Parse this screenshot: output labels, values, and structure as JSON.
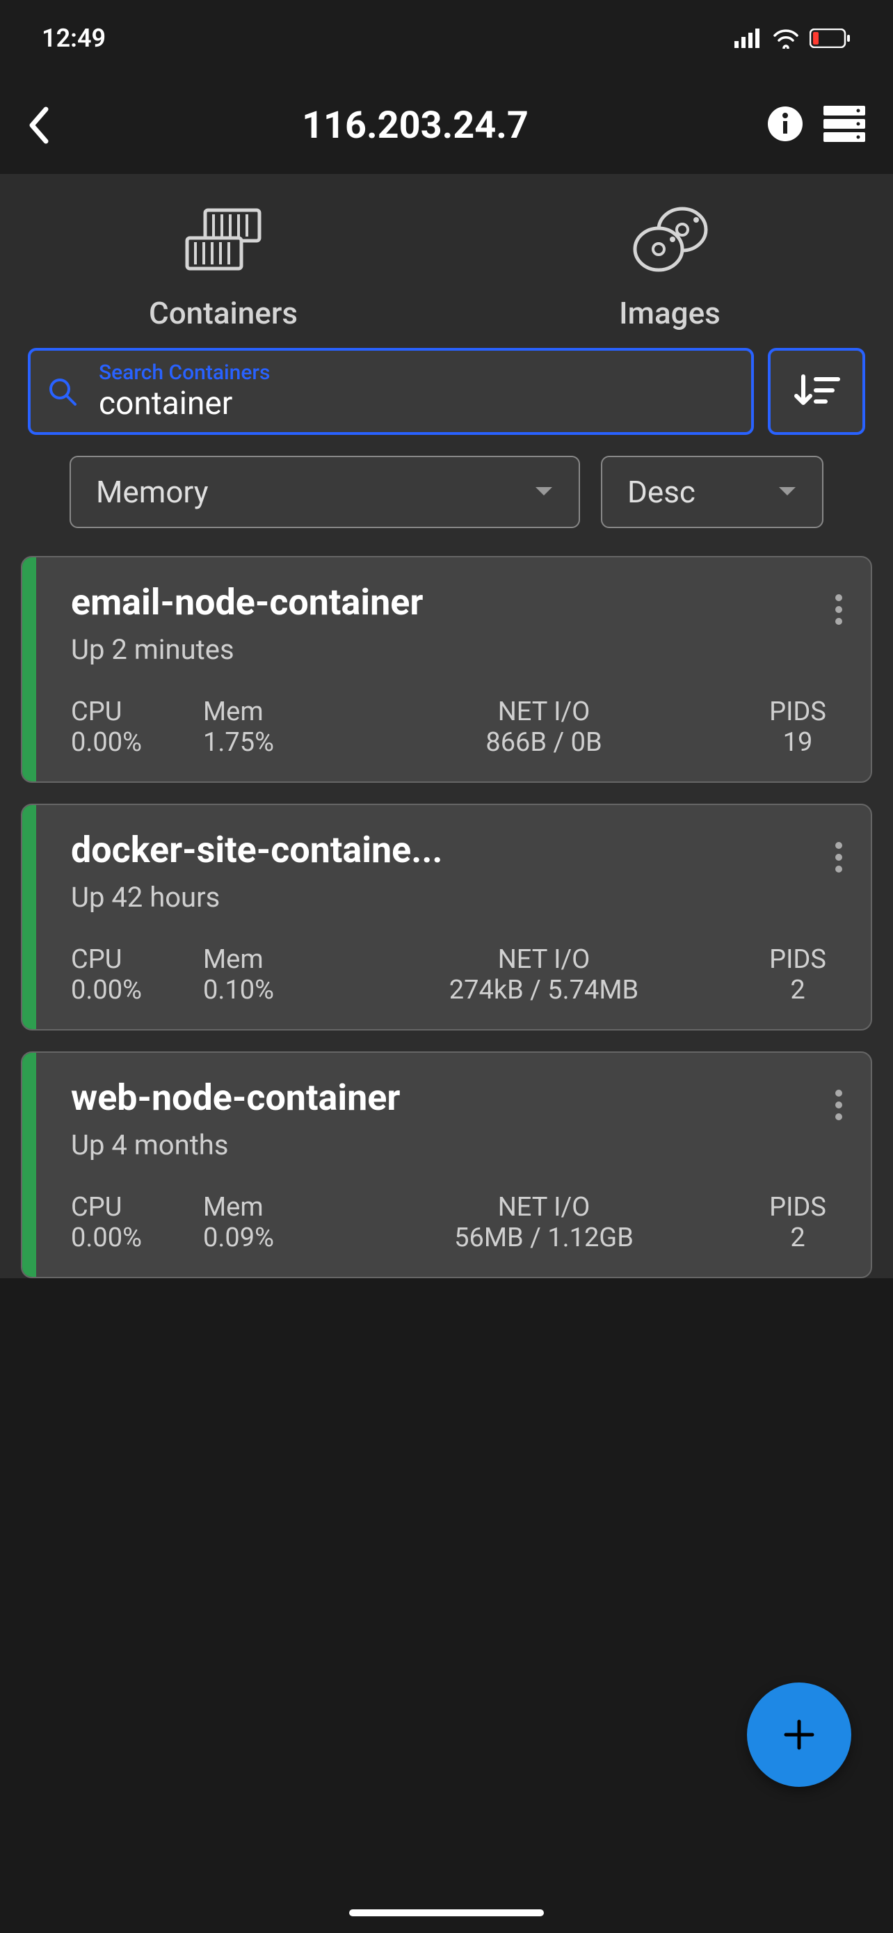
{
  "status": {
    "time": "12:49"
  },
  "header": {
    "title": "116.203.24.7"
  },
  "tabs": {
    "containers": "Containers",
    "images": "Images"
  },
  "search": {
    "label": "Search Containers",
    "value": "container"
  },
  "sort": {
    "field": "Memory",
    "order": "Desc"
  },
  "stat_labels": {
    "cpu": "CPU",
    "mem": "Mem",
    "net": "NET I/O",
    "pids": "PIDS"
  },
  "containers": [
    {
      "name": "email-node-container",
      "status": "Up 2 minutes",
      "cpu": "0.00%",
      "mem": "1.75%",
      "net": "866B / 0B",
      "pids": "19"
    },
    {
      "name": "docker-site-containe...",
      "status": "Up 42 hours",
      "cpu": "0.00%",
      "mem": "0.10%",
      "net": "274kB / 5.74MB",
      "pids": "2"
    },
    {
      "name": "web-node-container",
      "status": "Up 4 months",
      "cpu": "0.00%",
      "mem": "0.09%",
      "net": "56MB / 1.12GB",
      "pids": "2"
    }
  ]
}
